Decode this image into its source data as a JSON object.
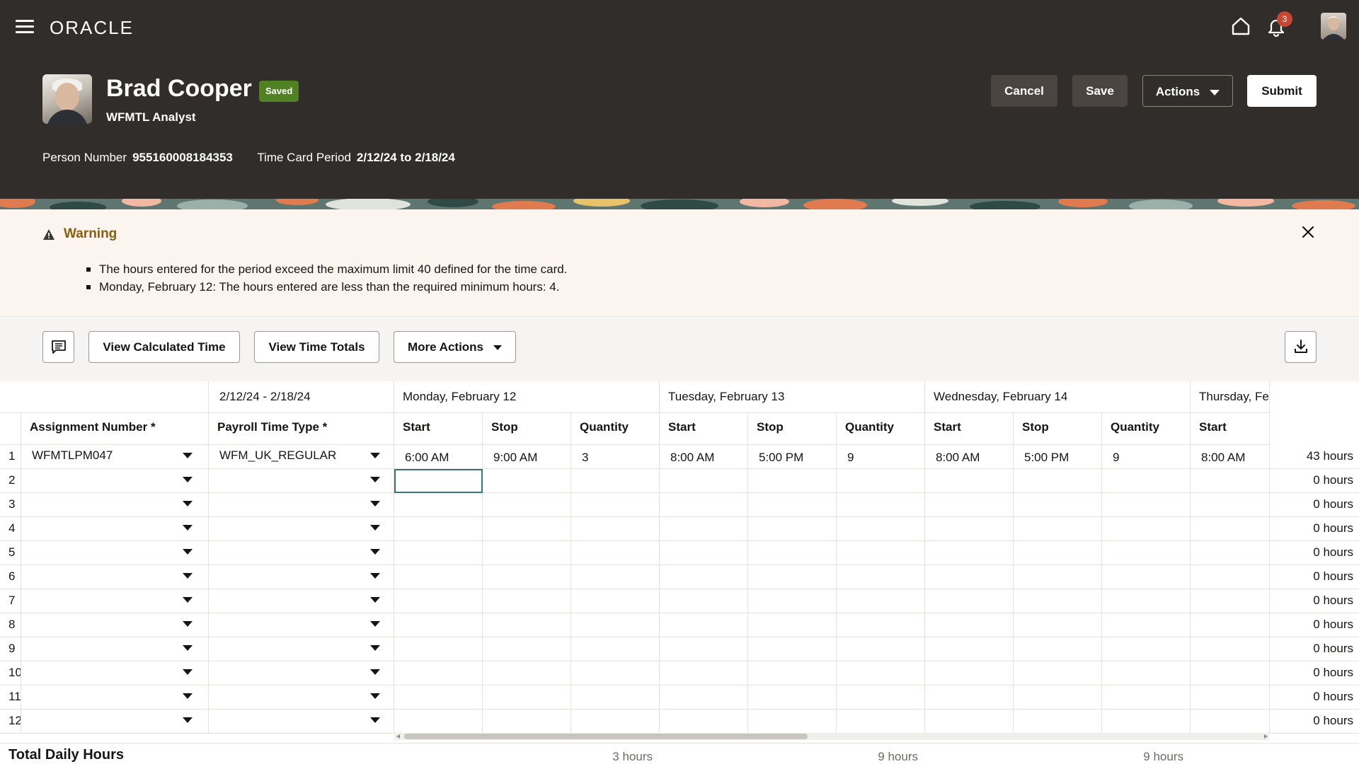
{
  "app": {
    "logo": "ORACLE",
    "notification_count": "3"
  },
  "person": {
    "name": "Brad Cooper",
    "status_badge": "Saved",
    "title": "WFMTL Analyst",
    "person_number_label": "Person Number",
    "person_number": "955160008184353",
    "period_label": "Time Card Period",
    "period": "2/12/24 to 2/18/24"
  },
  "header_actions": {
    "cancel": "Cancel",
    "save": "Save",
    "actions": "Actions",
    "submit": "Submit"
  },
  "warning": {
    "title": "Warning",
    "messages": [
      "The hours entered for the period exceed the maximum limit 40 defined for the time card.",
      "Monday, February 12: The hours entered are less than the required minimum hours: 4."
    ]
  },
  "toolbar": {
    "view_calculated_time": "View Calculated Time",
    "view_time_totals": "View Time Totals",
    "more_actions": "More Actions"
  },
  "grid": {
    "period_header": "2/12/24 - 2/18/24",
    "day_headers": [
      "Monday, February 12",
      "Tuesday, February 13",
      "Wednesday, February 14",
      "Thursday, Febr"
    ],
    "columns": {
      "assignment": "Assignment Number *",
      "payroll_type": "Payroll Time Type *",
      "start": "Start",
      "stop": "Stop",
      "quantity": "Quantity"
    },
    "rows": [
      {
        "num": "1",
        "assignment": "WFMTLPM047",
        "payroll_type": "WFM_UK_REGULAR",
        "mon_start": "6:00 AM",
        "mon_stop": "9:00 AM",
        "mon_qty": "3",
        "tue_start": "8:00 AM",
        "tue_stop": "5:00 PM",
        "tue_qty": "9",
        "wed_start": "8:00 AM",
        "wed_stop": "5:00 PM",
        "wed_qty": "9",
        "thu_start": "8:00 AM",
        "hours": "43 hours"
      },
      {
        "num": "2",
        "hours": "0 hours"
      },
      {
        "num": "3",
        "hours": "0 hours"
      },
      {
        "num": "4",
        "hours": "0 hours"
      },
      {
        "num": "5",
        "hours": "0 hours"
      },
      {
        "num": "6",
        "hours": "0 hours"
      },
      {
        "num": "7",
        "hours": "0 hours"
      },
      {
        "num": "8",
        "hours": "0 hours"
      },
      {
        "num": "9",
        "hours": "0 hours"
      },
      {
        "num": "10",
        "hours": "0 hours"
      },
      {
        "num": "11",
        "hours": "0 hours"
      },
      {
        "num": "12",
        "hours": "0 hours"
      }
    ],
    "totals": {
      "label": "Total Daily Hours",
      "monday": "3 hours",
      "tuesday": "9 hours",
      "wednesday": "9 hours"
    }
  },
  "colors": {
    "header_bg": "#312d2a",
    "badge_saved": "#508223",
    "warning_text": "#8a5c0f",
    "notification_badge": "#c74634"
  }
}
